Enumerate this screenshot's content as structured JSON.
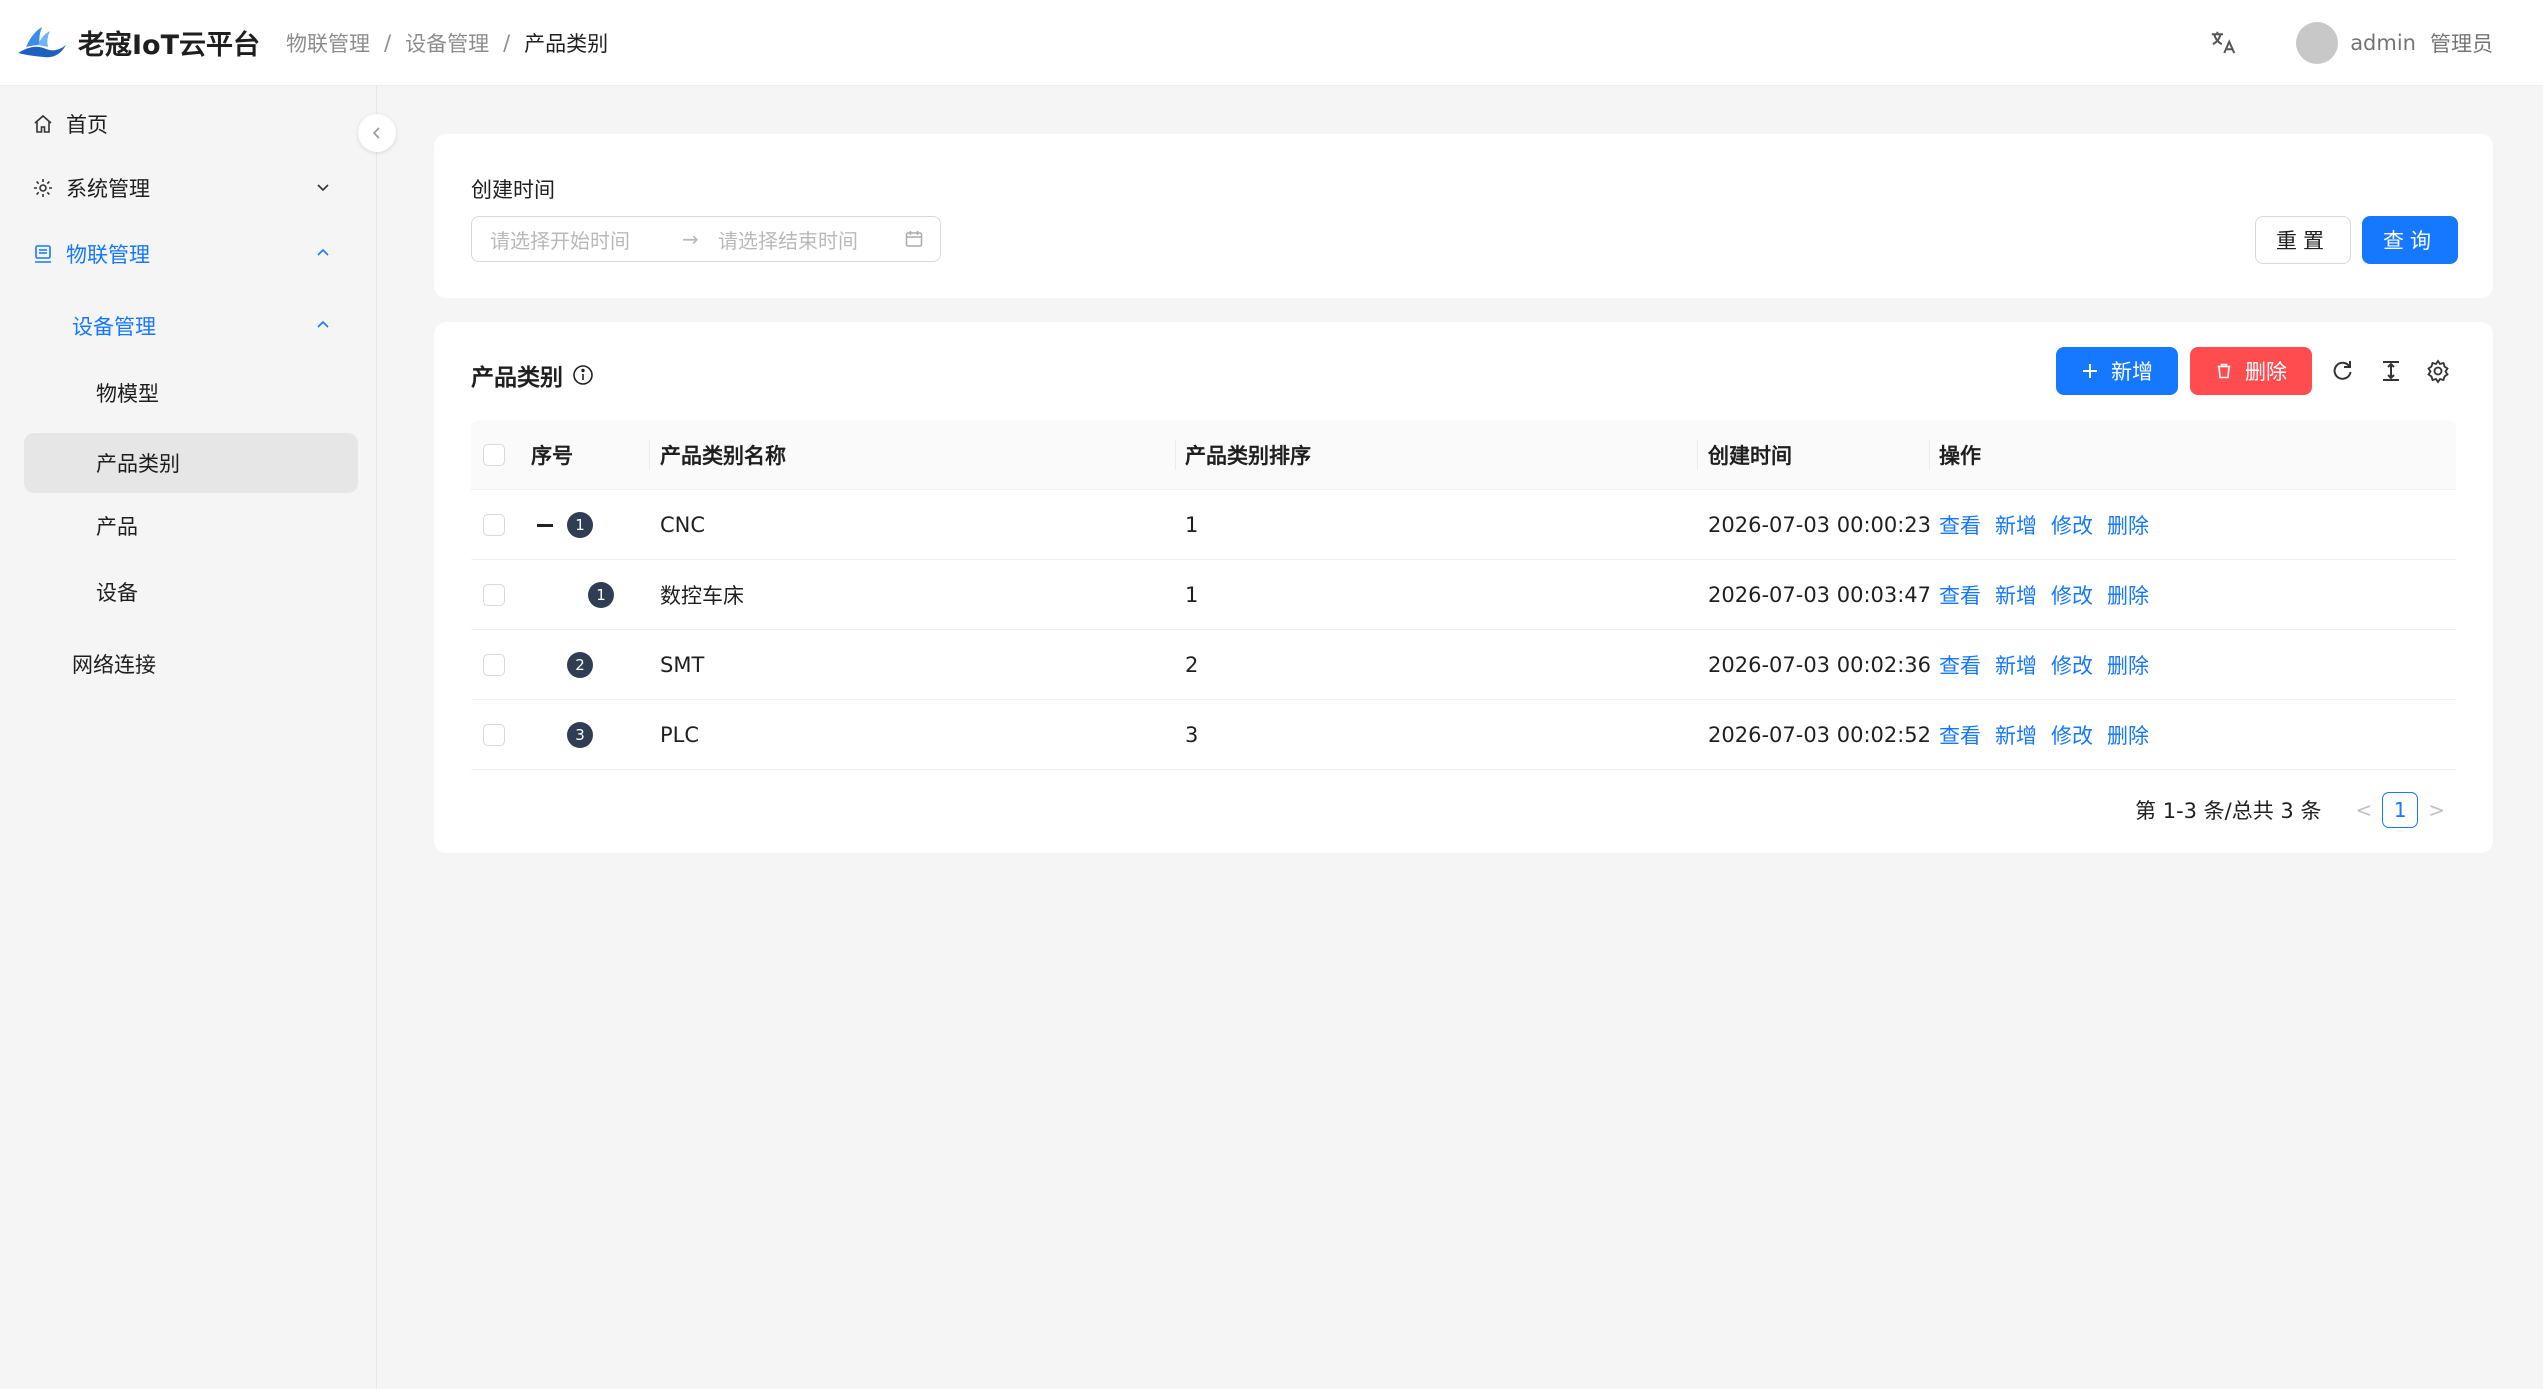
{
  "header": {
    "app_title": "老寇IoT云平台",
    "breadcrumb": [
      "物联管理",
      "设备管理",
      "产品类别"
    ],
    "username": "admin",
    "role": "管理员"
  },
  "sidebar": {
    "items": [
      {
        "label": "首页",
        "icon": "home-icon"
      },
      {
        "label": "系统管理",
        "icon": "gear-icon"
      },
      {
        "label": "物联管理",
        "icon": "iot-icon"
      },
      {
        "label": "设备管理"
      },
      {
        "label": "物模型"
      },
      {
        "label": "产品类别"
      },
      {
        "label": "产品"
      },
      {
        "label": "设备"
      },
      {
        "label": "网络连接"
      }
    ]
  },
  "search": {
    "field_label": "创建时间",
    "start_placeholder": "请选择开始时间",
    "end_placeholder": "请选择结束时间",
    "reset_label": "重置",
    "query_label": "查询"
  },
  "table": {
    "title": "产品类别",
    "add_label": "新增",
    "delete_label": "删除",
    "columns": [
      "序号",
      "产品类别名称",
      "产品类别排序",
      "创建时间",
      "操作"
    ],
    "rows": [
      {
        "index": "1",
        "name": "CNC",
        "sort": "1",
        "created": "2026-07-03 00:00:23",
        "level": 0,
        "expanded": true
      },
      {
        "index": "1",
        "name": "数控车床",
        "sort": "1",
        "created": "2026-07-03 00:03:47",
        "level": 1
      },
      {
        "index": "2",
        "name": "SMT",
        "sort": "2",
        "created": "2026-07-03 00:02:36",
        "level": 0
      },
      {
        "index": "3",
        "name": "PLC",
        "sort": "3",
        "created": "2026-07-03 00:02:52",
        "level": 0
      }
    ],
    "row_actions": [
      "查看",
      "新增",
      "修改",
      "删除"
    ],
    "pagination": {
      "total_text": "第 1-3 条/总共 3 条",
      "current_page": "1"
    }
  },
  "colors": {
    "primary": "#1677ff",
    "danger": "#ff4d4f",
    "badge": "#2f3e52"
  }
}
